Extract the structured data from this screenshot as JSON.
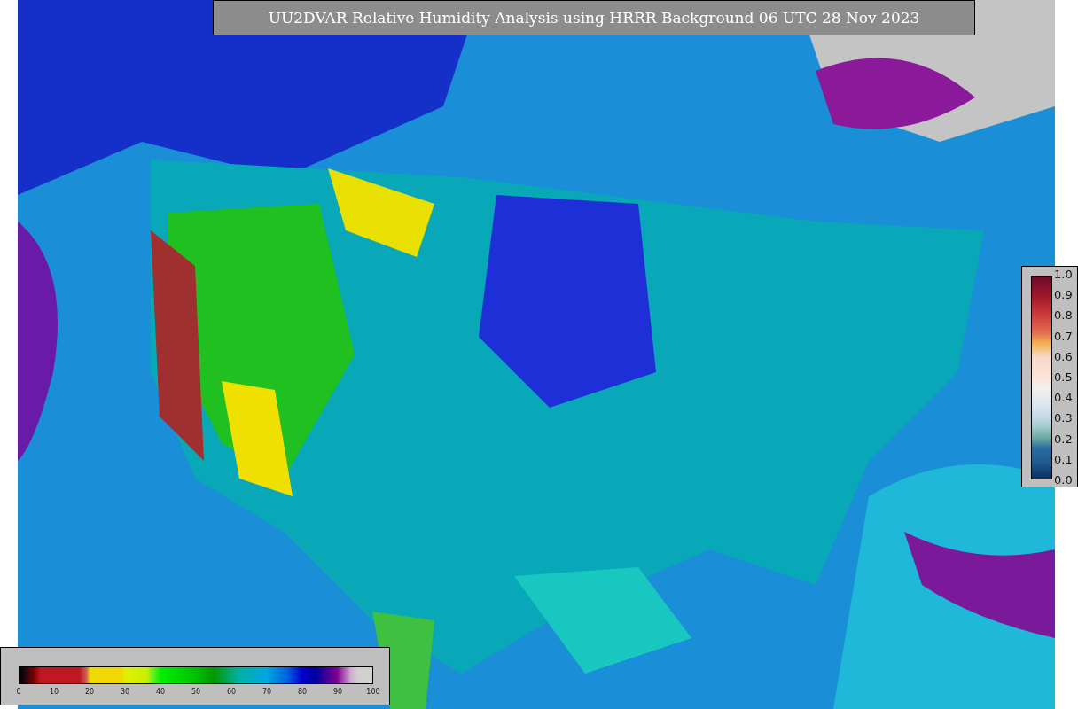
{
  "title": "UU2DVAR Relative Humidity Analysis using HRRR Background 06 UTC 28 Nov 2023",
  "colorbars": [
    {
      "kind": "horizontal",
      "ticks": [
        "0",
        "10",
        "20",
        "30",
        "40",
        "50",
        "60",
        "70",
        "80",
        "90",
        "100"
      ]
    },
    {
      "kind": "vertical",
      "ticks": [
        "1.0",
        "0.9",
        "0.8",
        "0.7",
        "0.6",
        "0.5",
        "0.4",
        "0.3",
        "0.2",
        "0.1",
        "0.0"
      ]
    }
  ]
}
